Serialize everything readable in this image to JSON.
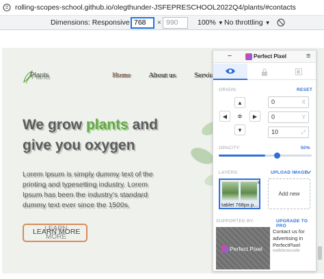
{
  "browser": {
    "url": "rolling-scopes-school.github.io/olegthunder-JSFEPRESCHOOL2022Q4/plants/#contacts"
  },
  "devtools": {
    "dimensions_label": "Dimensions: Responsive",
    "width_value": "768",
    "height_placeholder": "990",
    "times": "×",
    "zoom": "100%",
    "throttling": "No throttling",
    "caret": "▼"
  },
  "site": {
    "logo_text": "Plants",
    "nav": [
      "Home",
      "About us",
      "Servic"
    ],
    "hero": {
      "title_line1_a": "We grow ",
      "title_line1_b": "plants",
      "title_line1_c": " and",
      "title_line2": "give you oxygen",
      "description": "Lorem Ipsum is simply dummy text of the printing and typesetting industry. Lorem Ipsum has been the industry's standard dummy text ever since the 1500s.",
      "button_label": "LEARN MORE",
      "button_ghost": "LEARN MORE"
    },
    "colors": {
      "accent_green": "#65a849",
      "button_border": "#d88b57",
      "background": "#eef1ec"
    }
  },
  "perfectpixel": {
    "minimize_label": "−",
    "title": "Perfect Pixel",
    "menu_icon": "≡",
    "tabs": [
      "eye-icon",
      "lock-icon",
      "layers-swap-icon"
    ],
    "origin_label": "ORIGIN:",
    "reset_label": "RESET",
    "arrows": {
      "up": "▲",
      "down": "▼",
      "left": "◀",
      "right": "▶",
      "center": "Φ"
    },
    "fields": {
      "x": {
        "value": "0",
        "suffix": "X"
      },
      "y": {
        "value": "0",
        "suffix": "Y"
      },
      "scale": {
        "value": "10",
        "suffix": "⤢"
      }
    },
    "opacity_label": "OPACITY:",
    "opacity_value": "50%",
    "opacity_fraction": 0.5,
    "layers_label": "LAYERS:",
    "upload_label": "UPLOAD IMAGE",
    "layer_caption": "tablet 768px.p...",
    "layer_close": "×",
    "add_new_label": "Add new",
    "supported_label": "SUPPORTED BY:",
    "upgrade_label": "UPGRADE TO PRO",
    "sponsor_name": "Perfect Pixel",
    "sponsor_text": "Contact us for advertising in PerfectPixel",
    "sponsor_sub": "welldonecode"
  }
}
